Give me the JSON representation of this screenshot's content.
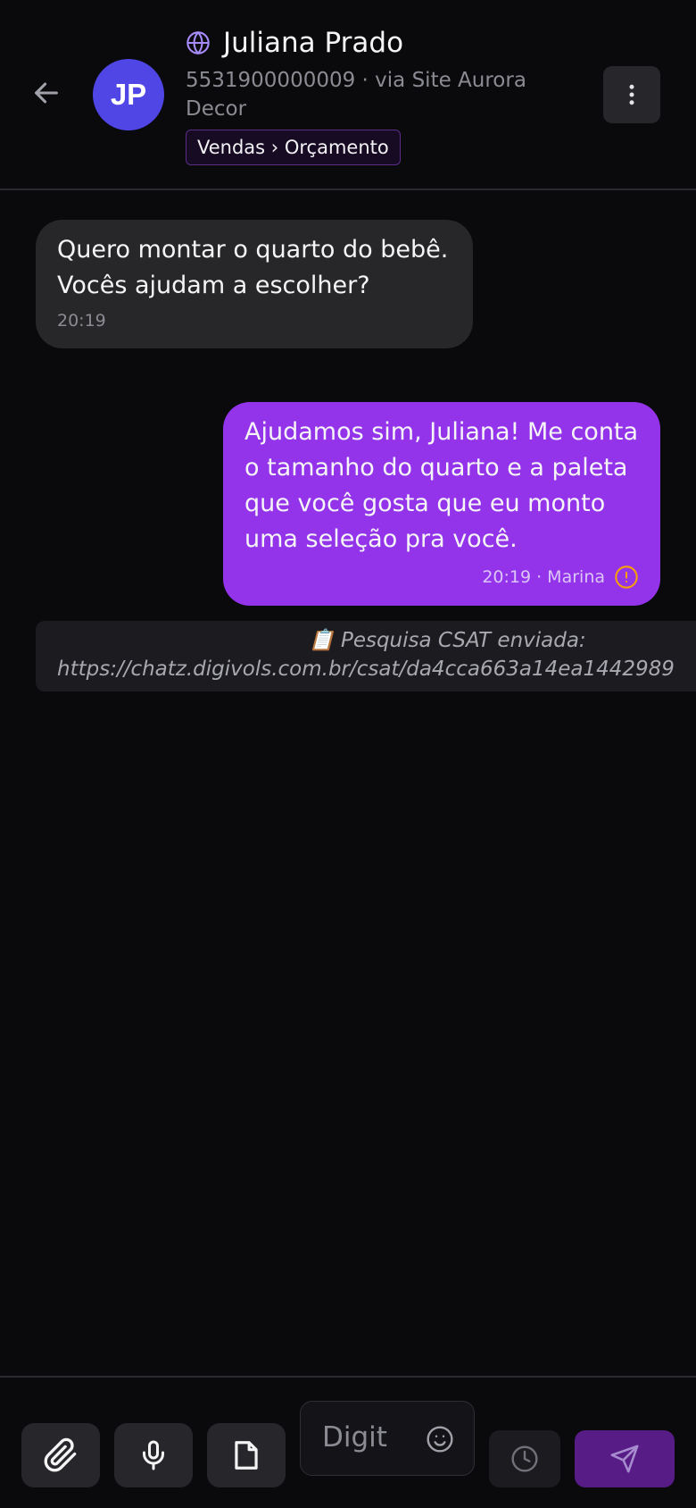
{
  "colors": {
    "background": "#0a0a0c",
    "accent": "#9333ea",
    "avatar": "#4f46e5",
    "incoming_bubble": "#27272a",
    "send_button": "#581c87",
    "warning": "#f59e0b"
  },
  "header": {
    "back_icon": "arrow-left-icon",
    "avatar_initials": "JP",
    "channel_icon": "globe-icon",
    "contact_name": "Juliana Prado",
    "contact_subtitle": "5531900000009 · via Site Aurora Decor",
    "tag_label": "Vendas › Orçamento",
    "menu_icon": "more-vertical-icon"
  },
  "messages": [
    {
      "direction": "incoming",
      "text": "Quero montar o quarto do bebê. Vocês ajudam a escolher?",
      "time": "20:19"
    },
    {
      "direction": "outgoing",
      "text": "Ajudamos sim, Juliana! Me conta o tamanho do quarto e a paleta que você gosta que eu monto uma seleção pra você.",
      "meta": "20:19 · Marina",
      "status_icon": "alert-circle-icon"
    }
  ],
  "system_note": {
    "line1": "📋 Pesquisa CSAT enviada:",
    "line2": "https://chatz.digivols.com.br/csat/da4cca663a14ea1442989"
  },
  "composer": {
    "attach_icon": "paperclip-icon",
    "mic_icon": "microphone-icon",
    "file_icon": "file-icon",
    "input_placeholder": "Digit",
    "emoji_icon": "smile-icon",
    "schedule_icon": "clock-icon",
    "send_icon": "send-icon"
  }
}
